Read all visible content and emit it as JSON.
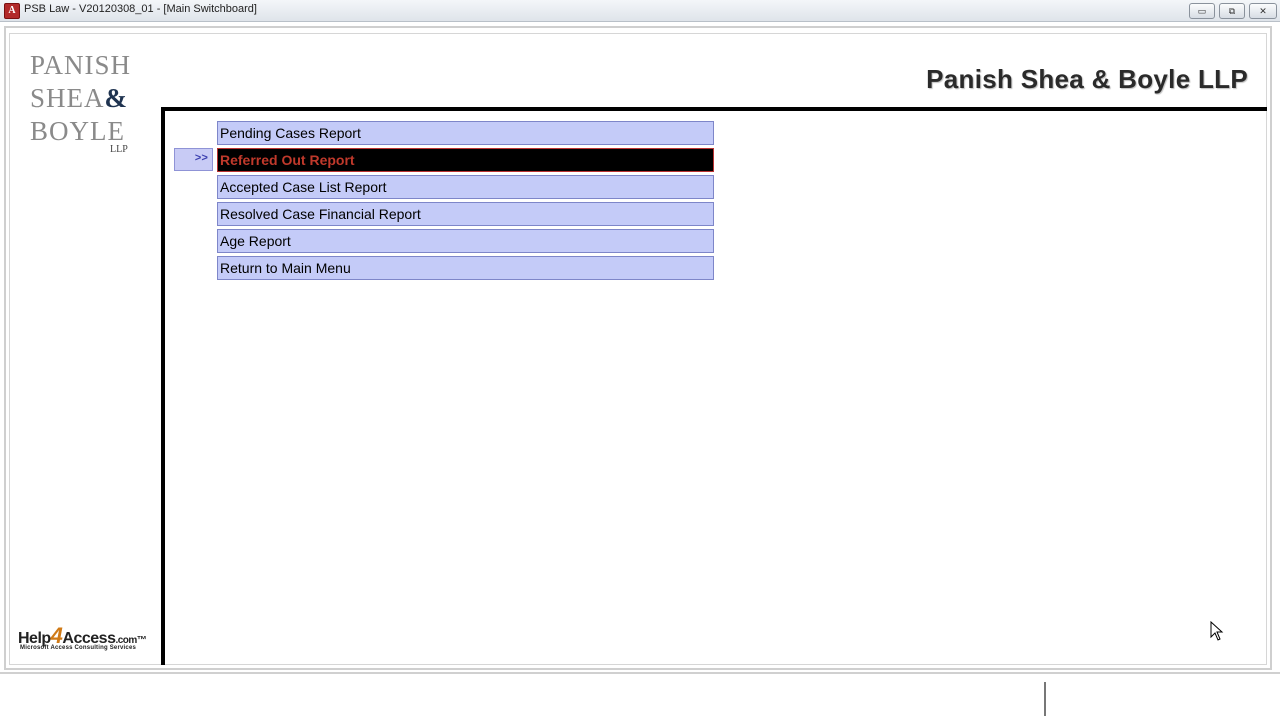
{
  "window": {
    "title": "PSB Law - V20120308_01 - [Main Switchboard]",
    "app_icon": "access-app-icon",
    "buttons": {
      "minimize": "▭",
      "restore": "⧉",
      "close": "✕"
    }
  },
  "logo": {
    "line1": "PANISH",
    "line2": "SHEA",
    "ampersand": "&",
    "line3": "BOYLE",
    "suffix": "LLP"
  },
  "header": {
    "firm_name": "Panish Shea & Boyle LLP"
  },
  "switchboard": {
    "selector_glyph": ">>",
    "items": [
      {
        "label": "Pending Cases Report"
      },
      {
        "label": "Referred Out Report"
      },
      {
        "label": "Accepted Case List Report"
      },
      {
        "label": "Resolved Case Financial Report"
      },
      {
        "label": "Age Report"
      },
      {
        "label": "Return to Main Menu"
      }
    ]
  },
  "footer_logo": {
    "help": "Help",
    "four": "4",
    "access": "Access",
    "domain": ".com",
    "tm": "™",
    "tagline": "Microsoft Access Consulting Services"
  },
  "colors": {
    "button_bg": "#c4cbf8",
    "selected_bg": "#000000",
    "selected_text": "#c0392b",
    "accent_orange": "#d07a16"
  }
}
